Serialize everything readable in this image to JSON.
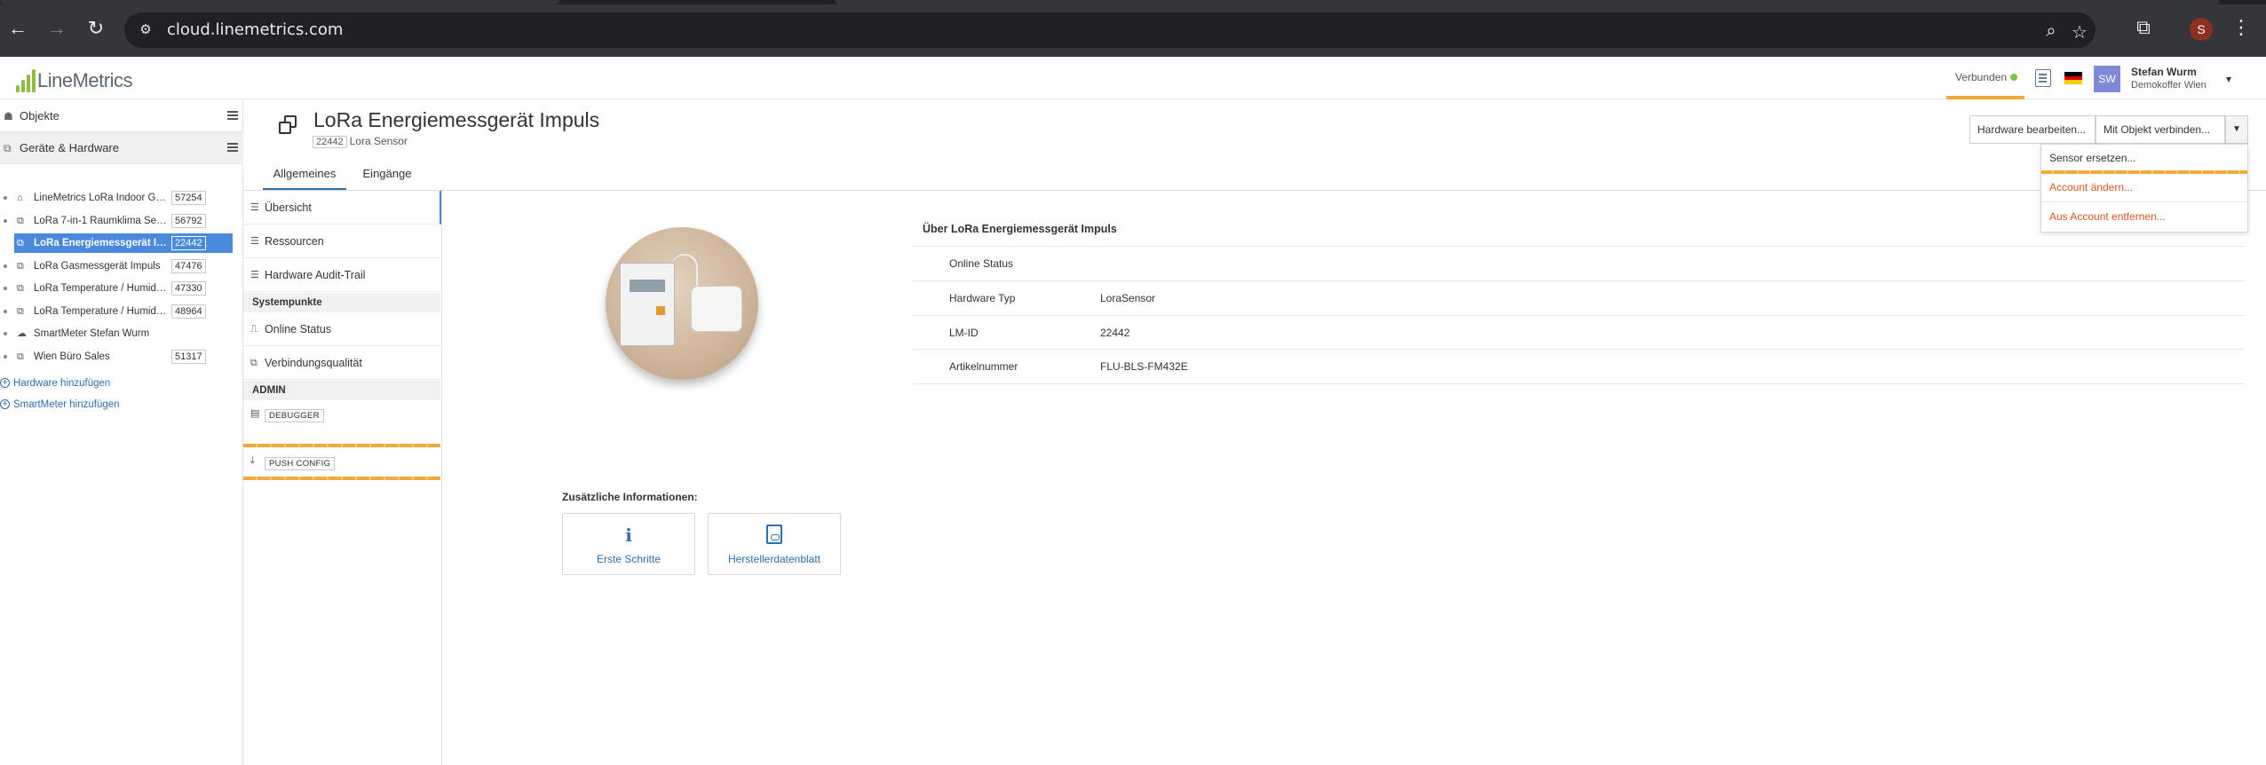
{
  "browser": {
    "url": "cloud.linemetrics.com",
    "profile_initial": "S",
    "icons": [
      "back-icon",
      "forward-icon",
      "reload-icon",
      "site-settings-icon",
      "zoom-icon",
      "bookmark-star-icon",
      "extensions-icon",
      "menu-dots-icon"
    ]
  },
  "header": {
    "brand": "LineMetrics",
    "status_label": "Verbunden",
    "avatar_initials": "SW",
    "user_name": "Stefan Wurm",
    "user_org": "Demokoffer Wien",
    "colors": {
      "brand_green": "#8dbd3f",
      "status_green": "#7cc243",
      "accent_orange": "#f0a93a",
      "primary_blue": "#4a89dc",
      "danger": "#d9531e"
    }
  },
  "sidebar": {
    "sections": [
      {
        "label": "Objekte",
        "icon": "objects-icon"
      },
      {
        "label": "Geräte & Hardware",
        "icon": "hardware-icon"
      }
    ],
    "items": [
      {
        "label": "LineMetrics LoRa Indoor Ga...",
        "id": "57254",
        "icon": "gateway-icon"
      },
      {
        "label": "LoRa 7-in-1 Raumklima Sen...",
        "id": "56792",
        "icon": "sensor-icon"
      },
      {
        "label": "LoRa Energiemessgerät Im...",
        "id": "22442",
        "icon": "sensor-icon",
        "selected": true
      },
      {
        "label": "LoRa Gasmessgerät Impuls",
        "id": "47476",
        "icon": "sensor-icon"
      },
      {
        "label": "LoRa Temperature / Humidit...",
        "id": "47330",
        "icon": "sensor-icon"
      },
      {
        "label": "LoRa Temperature / Humidit...",
        "id": "48964",
        "icon": "sensor-icon"
      },
      {
        "label": "SmartMeter Stefan Wurm",
        "id": "",
        "icon": "cloud-icon"
      },
      {
        "label": "Wien Büro Sales",
        "id": "51317",
        "icon": "sensor-icon"
      }
    ],
    "add_hardware": "Hardware hinzufügen",
    "add_smartmeter": "SmartMeter hinzufügen"
  },
  "device": {
    "title": "LoRa Energiemessgerät Impuls",
    "id": "22442",
    "type_label": "Lora Sensor"
  },
  "tabs": [
    {
      "label": "Allgemeines",
      "active": true
    },
    {
      "label": "Eingänge",
      "active": false
    }
  ],
  "actions": {
    "edit_hardware": "Hardware bearbeiten...",
    "connect_object": "Mit Objekt verbinden...",
    "dropdown": [
      {
        "label": "Sensor ersetzen...",
        "style": "normal"
      },
      {
        "label": "Account ändern...",
        "style": "danger"
      },
      {
        "label": "Aus Account entfernen...",
        "style": "danger"
      }
    ]
  },
  "section_nav": {
    "items": [
      {
        "label": "Übersicht",
        "icon": "list-icon"
      },
      {
        "label": "Ressourcen",
        "icon": "list-icon"
      },
      {
        "label": "Hardware Audit-Trail",
        "icon": "list-icon"
      }
    ],
    "group_systempunkte": "Systempunkte",
    "systempunkte": [
      {
        "label": "Online Status",
        "icon": "chart-icon"
      },
      {
        "label": "Verbindungsqualität",
        "icon": "link-icon"
      }
    ],
    "group_admin": "ADMIN",
    "admin_tools": [
      {
        "label": "DEBUGGER",
        "icon": "clipboard-icon"
      },
      {
        "label": "PUSH CONFIG",
        "icon": "download-icon"
      }
    ]
  },
  "info": {
    "title": "Über LoRa Energiemessgerät Impuls",
    "rows": [
      {
        "key": "Online Status",
        "value": ""
      },
      {
        "key": "Hardware Typ",
        "value": "LoraSensor"
      },
      {
        "key": "LM-ID",
        "value": "22442"
      },
      {
        "key": "Artikelnummer",
        "value": "FLU-BLS-FM432E"
      }
    ]
  },
  "additional": {
    "title": "Zusätzliche Informationen:",
    "cards": [
      {
        "label": "Erste Schritte",
        "icon": "info-icon"
      },
      {
        "label": "Herstellerdatenblatt",
        "icon": "pdf-icon"
      }
    ]
  }
}
